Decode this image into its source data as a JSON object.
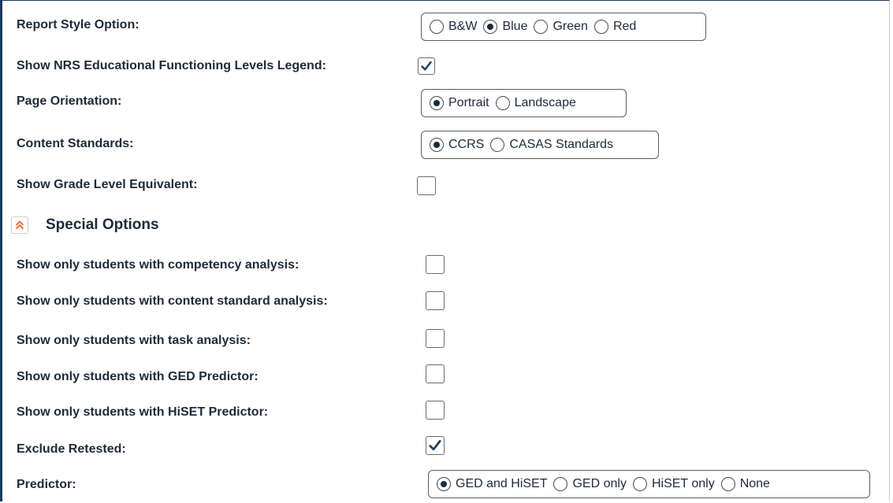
{
  "report_style": {
    "label": "Report Style Option:",
    "options": [
      "B&W",
      "Blue",
      "Green",
      "Red"
    ],
    "selected": "Blue"
  },
  "nrs_legend": {
    "label": "Show NRS Educational Functioning Levels Legend:",
    "checked": true
  },
  "page_orientation": {
    "label": "Page Orientation:",
    "options": [
      "Portrait",
      "Landscape"
    ],
    "selected": "Portrait"
  },
  "content_standards": {
    "label": "Content Standards:",
    "options": [
      "CCRS",
      "CASAS Standards"
    ],
    "selected": "CCRS"
  },
  "grade_level": {
    "label": "Show Grade Level Equivalent:",
    "checked": false
  },
  "special_options": {
    "title": "Special Options",
    "accent_color": "#e8743b",
    "items": [
      {
        "label": "Show only students with competency analysis:",
        "checked": false
      },
      {
        "label": "Show only students with content standard analysis:",
        "checked": false
      },
      {
        "label": "Show only students with task analysis:",
        "checked": false
      },
      {
        "label": "Show only students with GED Predictor:",
        "checked": false
      },
      {
        "label": "Show only students with HiSET Predictor:",
        "checked": false
      },
      {
        "label": "Exclude Retested:",
        "checked": true
      }
    ]
  },
  "predictor": {
    "label": "Predictor:",
    "options": [
      "GED and HiSET",
      "GED only",
      "HiSET only",
      "None"
    ],
    "selected": "GED and HiSET"
  }
}
